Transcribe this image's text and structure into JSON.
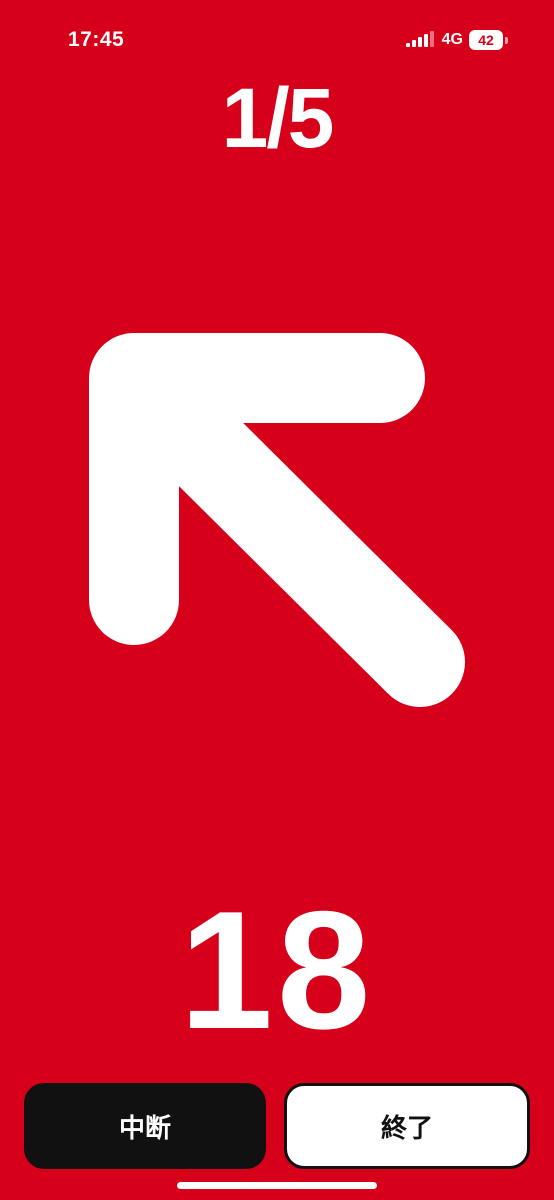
{
  "status_bar": {
    "time": "17:45",
    "network": "4G",
    "battery": "42",
    "signal_icon": "cellular-signal-icon"
  },
  "progress": {
    "counter": "1/5",
    "current": 1,
    "total": 5
  },
  "direction": {
    "icon": "arrow-up-left-icon"
  },
  "timer": {
    "seconds": "18"
  },
  "buttons": {
    "pause_label": "中断",
    "end_label": "終了"
  },
  "colors": {
    "background": "#d7001a",
    "foreground": "#ffffff",
    "pause_button": "#111111",
    "end_button": "#ffffff"
  }
}
